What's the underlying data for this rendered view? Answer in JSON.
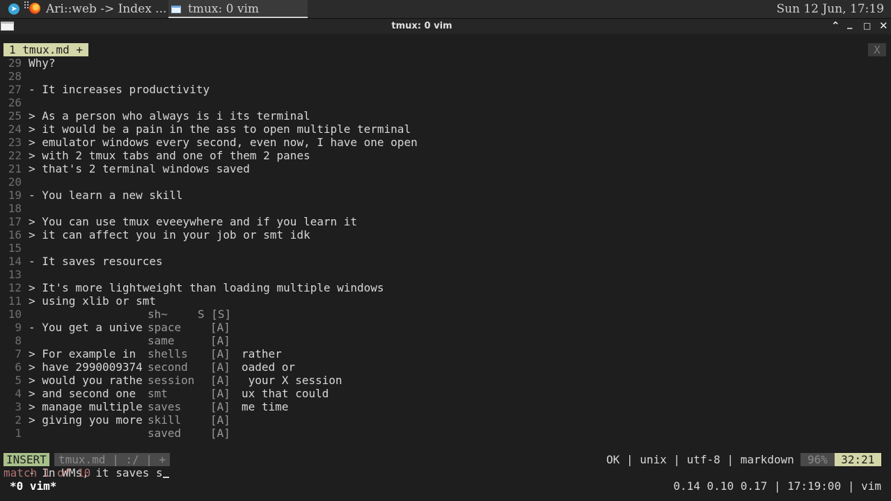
{
  "taskbar": {
    "tasks": [
      {
        "label": "Ari::web -> Index ...",
        "icon": "firefox-icon"
      },
      {
        "label": "tmux: 0 vim",
        "icon": "terminal-icon"
      }
    ],
    "clock": "Sun 12 Jun, 17:19"
  },
  "window": {
    "title": "tmux: 0 vim",
    "controls": {
      "keep_above": "⌃",
      "minimize": "_",
      "maximize": "□",
      "close": "✕"
    }
  },
  "vim": {
    "tab_label": "1 tmux.md +",
    "tab_close": "X",
    "lines": [
      {
        "num": "29",
        "text": "Why?"
      },
      {
        "num": "28",
        "text": ""
      },
      {
        "num": "27",
        "text": "- It increases productivity"
      },
      {
        "num": "26",
        "text": ""
      },
      {
        "num": "25",
        "text": "> As a person who always is i its terminal"
      },
      {
        "num": "24",
        "text": "> it would be a pain in the ass to open multiple terminal"
      },
      {
        "num": "23",
        "text": "> emulator windows every second, even now, I have one open"
      },
      {
        "num": "22",
        "text": "> with 2 tmux tabs and one of them 2 panes"
      },
      {
        "num": "21",
        "text": "> that's 2 terminal windows saved"
      },
      {
        "num": "20",
        "text": ""
      },
      {
        "num": "19",
        "text": "- You learn a new skill"
      },
      {
        "num": "18",
        "text": ""
      },
      {
        "num": "17",
        "text": "> You can use tmux eveeywhere and if you learn it"
      },
      {
        "num": "16",
        "text": "> it can affect you in your job or smt idk"
      },
      {
        "num": "15",
        "text": ""
      },
      {
        "num": "14",
        "text": "- It saves resources"
      },
      {
        "num": "13",
        "text": ""
      },
      {
        "num": "12",
        "text": "> It's more lightweight than loading multiple windows"
      },
      {
        "num": "11",
        "text": "> using xlib or smt"
      }
    ],
    "popup_lines": [
      {
        "num": "10",
        "left": "",
        "word": "sh~",
        "kind": "S [S]",
        "right": ""
      },
      {
        "num": "9",
        "left": "- You get a univer",
        "word": "space",
        "kind": "[A]",
        "right": ""
      },
      {
        "num": "8",
        "left": "",
        "word": "same",
        "kind": "[A]",
        "right": ""
      },
      {
        "num": "7",
        "left": "> For example in a",
        "word": "shells",
        "kind": "[A]",
        "right": "rather"
      },
      {
        "num": "6",
        "left": "> have 29900093749",
        "word": "second",
        "kind": "[A]",
        "right": "oaded or"
      },
      {
        "num": "5",
        "left": "> would you rather",
        "word": "session",
        "kind": "[A]",
        "right": " your X session"
      },
      {
        "num": "4",
        "left": "> and second one f",
        "word": "smt",
        "kind": "[A]",
        "right": "ux that could"
      },
      {
        "num": "3",
        "left": "> manage multiple",
        "word": "saves",
        "kind": "[A]",
        "right": "me time"
      },
      {
        "num": "2",
        "left": "> giving you more",
        "word": "skill",
        "kind": "[A]",
        "right": ""
      },
      {
        "num": "1",
        "left": "",
        "word": "saved",
        "kind": "[A]",
        "right": ""
      }
    ],
    "current_line": {
      "num": "32",
      "text": "- In WMs, it saves s"
    },
    "status": {
      "mode": "INSERT",
      "file": "tmux.md | :/ | +",
      "info": "OK | unix | utf-8 | markdown ",
      "percent": " 96% ",
      "position": " 32:21 "
    },
    "message": "match 1 of 10"
  },
  "tmux": {
    "window": "*0 vim*",
    "right": "0.14 0.10 0.17 | 17:19:00 | vim"
  }
}
